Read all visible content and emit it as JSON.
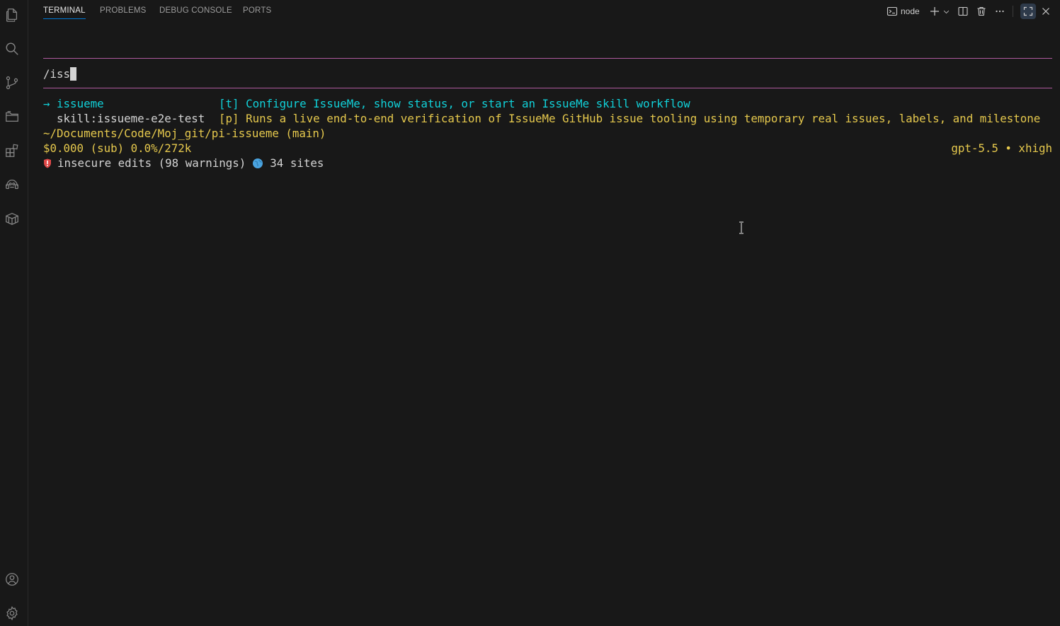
{
  "panel": {
    "tabs": [
      {
        "label": "TERMINAL",
        "active": true
      },
      {
        "label": "PROBLEMS",
        "active": false
      },
      {
        "label": "DEBUG CONSOLE",
        "active": false
      },
      {
        "label": "PORTS",
        "active": false
      }
    ],
    "terminal_name": "node"
  },
  "terminal": {
    "input": "/iss",
    "suggestions": [
      {
        "marker": "→ ",
        "name": "issueme",
        "tag": "[t]",
        "description": "Configure IssueMe, show status, or start an IssueMe skill workflow"
      },
      {
        "marker": "  ",
        "name": "skill:issueme-e2e-test",
        "tag": "[p]",
        "description": "Runs a live end-to-end verification of IssueMe GitHub issue tooling using temporary real issues, labels, and milestone"
      }
    ],
    "cwd": "~/Documents/Code/Moj_git/pi-issueme (main)",
    "cost": "$0.000 (sub) 0.0%/272k",
    "model": "gpt-5.5 • xhigh",
    "warnings": "insecure edits (98 warnings)",
    "sites": "34 sites"
  },
  "colors": {
    "accent": "#0078d4",
    "rule": "#b05a9e",
    "cyan": "#11d1d9",
    "yellow": "#e6c94d"
  }
}
